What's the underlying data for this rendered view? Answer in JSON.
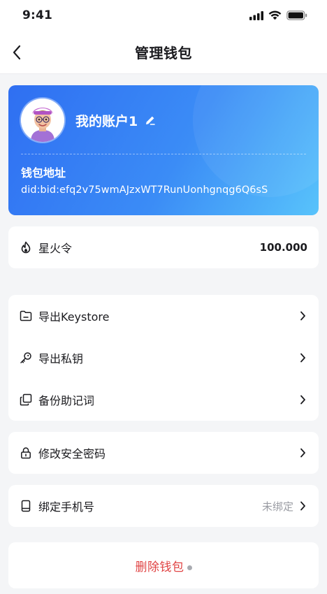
{
  "status_bar": {
    "time": "9:41"
  },
  "nav": {
    "title": "管理钱包"
  },
  "wallet": {
    "account_name": "我的账户1",
    "address_label": "钱包地址",
    "address": "did:bid:efq2v75wmAJzxWT7RunUonhgnqg6Q6sS"
  },
  "token": {
    "label": "星火令",
    "value": "100.000"
  },
  "menu": {
    "export_keystore": "导出Keystore",
    "export_private_key": "导出私钥",
    "backup_mnemonic": "备份助记词"
  },
  "security": {
    "change_password": "修改安全密码"
  },
  "phone": {
    "label": "绑定手机号",
    "status": "未绑定"
  },
  "delete": {
    "label": "删除钱包"
  },
  "colors": {
    "card_gradient_start": "#2f6ff2",
    "card_gradient_end": "#58c3fb",
    "danger": "#e04444"
  }
}
